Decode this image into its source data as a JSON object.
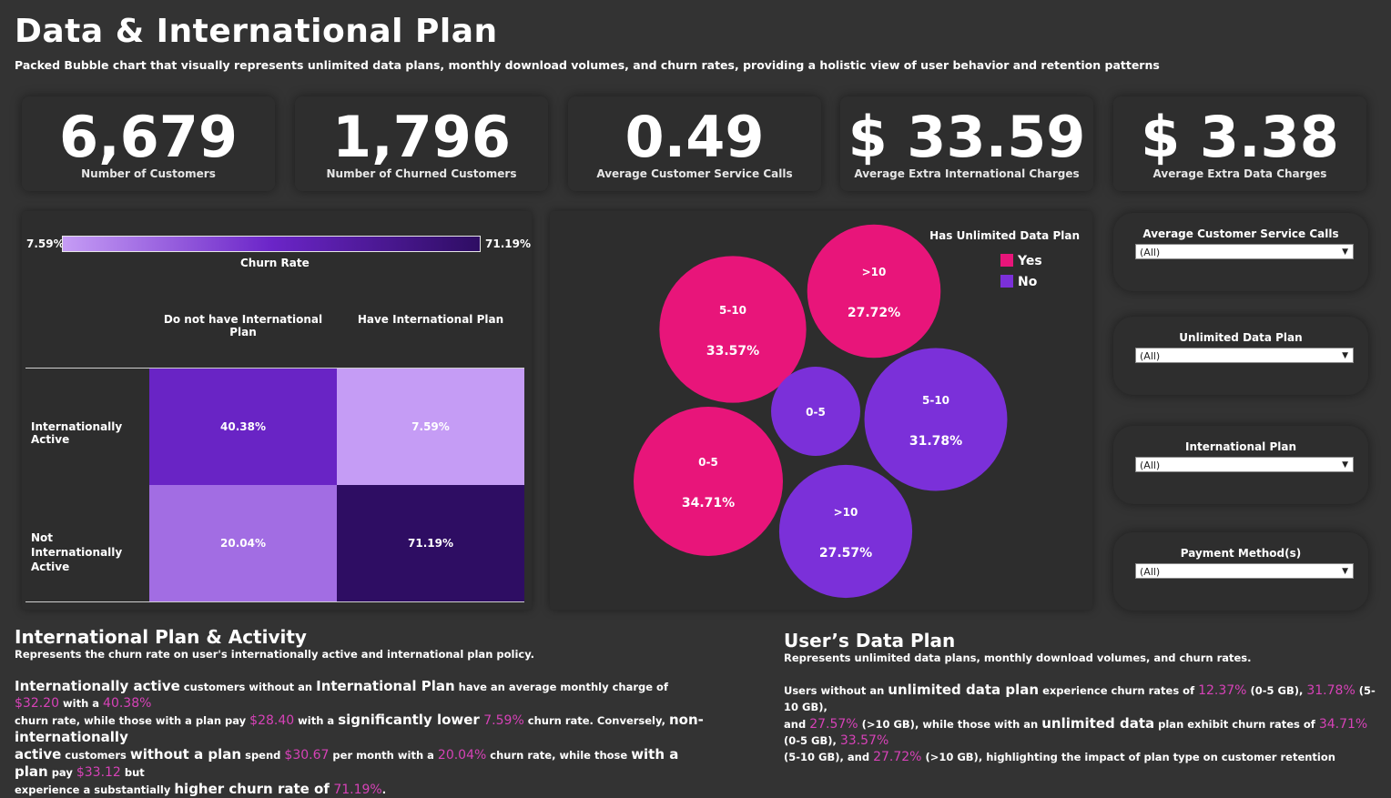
{
  "header": {
    "title": "Data & International Plan",
    "subtitle": "Packed Bubble chart that visually represents unlimited data plans, monthly download volumes, and churn rates, providing a holistic view of user behavior and retention patterns"
  },
  "kpis": [
    {
      "value": "6,679",
      "label": "Number of Customers"
    },
    {
      "value": "1,796",
      "label": "Number of Churned Customers"
    },
    {
      "value": "0.49",
      "label": "Average Customer Service Calls"
    },
    {
      "value": "$ 33.59",
      "label": "Average Extra International Charges"
    },
    {
      "value": "$ 3.38",
      "label": "Average Extra Data Charges"
    }
  ],
  "heatmap_legend": {
    "min": "7.59%",
    "max": "71.19%",
    "title": "Churn Rate"
  },
  "filters": [
    {
      "label": "Average Customer Service Calls",
      "value": "(All)"
    },
    {
      "label": "Unlimited Data Plan",
      "value": "(All)"
    },
    {
      "label": "International Plan",
      "value": "(All)"
    },
    {
      "label": "Payment Method(s)",
      "value": "(All)"
    }
  ],
  "sections": {
    "intl": {
      "title": "International Plan & Activity",
      "subtitle": "Represents the churn rate on user's internationally active and international plan policy."
    },
    "data": {
      "title": "User’s Data Plan",
      "subtitle": "Represents unlimited data plans, monthly download volumes, and churn rates."
    }
  },
  "intl_text": {
    "t1": "Internationally active",
    "t2": " customers without an ",
    "t3": "International Plan",
    "t4": " have an average monthly charge of ",
    "v1": "$32.20",
    "t5": " with a ",
    "v2": "40.38%",
    "t6": "churn rate, while those with a plan pay ",
    "v3": "$28.40",
    "t7": " with a ",
    "t8": "significantly lower",
    "v4": " 7.59%",
    "t9": " churn rate. Conversely, ",
    "t10": "non-internationally",
    "t11": "active",
    "t12": " customers ",
    "t13": "without a plan",
    "t14": " spend ",
    "v5": "$30.67",
    "t15": " per month with a ",
    "v6": "20.04%",
    "t16": " churn rate, while those ",
    "t17": "with a plan",
    "t18": " pay ",
    "v7": "$33.12",
    "t19": " but",
    "t20": "experience a substantially ",
    "t21": "higher churn rate of",
    "v8": " 71.19%",
    "t22": "."
  },
  "data_text": {
    "t1": "Users without an ",
    "t2": "unlimited data plan",
    "t3": " experience churn rates of ",
    "v1": "12.37%",
    "t4": " (0-5 GB), ",
    "v2": "31.78%",
    "t5": " (5-10 GB),",
    "t6": "and ",
    "v3": "27.57%",
    "t7": " (>10 GB), while those with an ",
    "t8": "unlimited data",
    "t9": " plan exhibit churn rates of ",
    "v4": "34.71%",
    "t10": " (0-5 GB), ",
    "v5": "33.57%",
    "t11": "(5-10 GB), and ",
    "v6": "27.72%",
    "t12": " (>10 GB), highlighting the impact of plan type on customer retention"
  },
  "colors": {
    "yes": "#e8157a",
    "no": "#7b30d9",
    "accent": "#d642b7"
  },
  "chart_data": [
    {
      "type": "heatmap",
      "title": "",
      "columns": [
        "Do not have International Plan",
        "Have International Plan"
      ],
      "rows": [
        "Internationally Active",
        "Not Internationally Active"
      ],
      "values": [
        [
          40.38,
          7.59
        ],
        [
          20.04,
          71.19
        ]
      ],
      "labels": [
        [
          "40.38%",
          "7.59%"
        ],
        [
          "20.04%",
          "71.19%"
        ]
      ],
      "color_range": [
        7.59,
        71.19
      ],
      "legend_title": "Churn Rate"
    },
    {
      "type": "bubble",
      "legend_title": "Has Unlimited Data Plan",
      "legend_position": "top-right",
      "series": [
        {
          "name": "Yes",
          "color": "#e8157a",
          "points": [
            {
              "label": ">10",
              "value": 27.72,
              "text": "27.72%"
            },
            {
              "label": "5-10",
              "value": 33.57,
              "text": "33.57%"
            },
            {
              "label": "0-5",
              "value": 34.71,
              "text": "34.71%"
            }
          ]
        },
        {
          "name": "No",
          "color": "#7b30d9",
          "points": [
            {
              "label": "0-5",
              "value": 12.37,
              "text": ""
            },
            {
              "label": "5-10",
              "value": 31.78,
              "text": "31.78%"
            },
            {
              "label": ">10",
              "value": 27.57,
              "text": "27.57%"
            }
          ]
        }
      ]
    }
  ]
}
